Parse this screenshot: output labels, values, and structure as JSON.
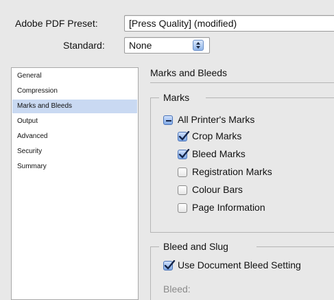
{
  "preset": {
    "label": "Adobe PDF Preset:",
    "value": "[Press Quality] (modified)"
  },
  "standard": {
    "label": "Standard:",
    "value": "None"
  },
  "sidebar": {
    "items": [
      {
        "label": "General"
      },
      {
        "label": "Compression"
      },
      {
        "label": "Marks and Bleeds",
        "selected": true
      },
      {
        "label": "Output"
      },
      {
        "label": "Advanced"
      },
      {
        "label": "Security"
      },
      {
        "label": "Summary"
      }
    ]
  },
  "panel": {
    "title": "Marks and Bleeds",
    "marks": {
      "group_label": "Marks",
      "all_printers_marks": {
        "label": "All Printer's Marks",
        "state": "mixed"
      },
      "crop_marks": {
        "label": "Crop Marks",
        "checked": true
      },
      "bleed_marks": {
        "label": "Bleed Marks",
        "checked": true
      },
      "registration_marks": {
        "label": "Registration Marks",
        "checked": false
      },
      "colour_bars": {
        "label": "Colour Bars",
        "checked": false
      },
      "page_information": {
        "label": "Page Information",
        "checked": false
      }
    },
    "bleed_slug": {
      "group_label": "Bleed and Slug",
      "use_document_bleed": {
        "label": "Use Document Bleed Setting",
        "checked": true
      },
      "bleed_label": "Bleed:"
    }
  },
  "colors": {
    "selection": "#c9d9f2",
    "checkbox_accent": "#7ea8e6"
  }
}
